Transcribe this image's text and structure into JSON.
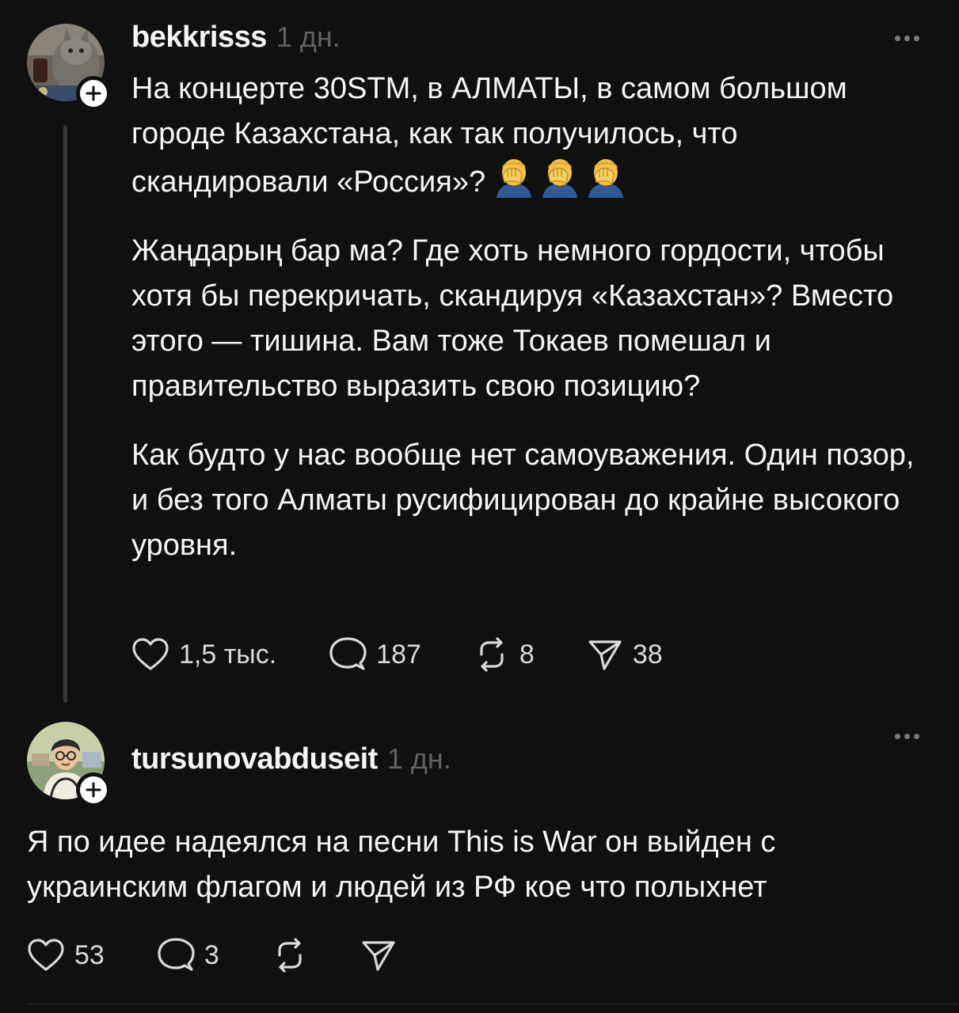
{
  "post1": {
    "username": "bekkrisss",
    "time": "1 дн.",
    "paragraph1": "На концерте 30STM, в АЛМАТЫ, в самом большом городе Казахстана, как так получилось, что скандировали «Россия»?",
    "paragraph1_emojis": [
      "facepalm-emoji",
      "facepalm-emoji",
      "facepalm-emoji"
    ],
    "paragraph2": "Жаңдарың бар ма? Где хоть немного гордости, чтобы хотя бы перекричать, скандируя «Казахстан»? Вместо этого — тишина. Вам тоже Токаев помешал и правительство выразить свою позицию?",
    "paragraph3": "Как будто у нас вообще нет самоуважения. Один позор, и без того Алматы русифицирован до крайне высокого уровня.",
    "likes": "1,5 тыс.",
    "replies": "187",
    "reposts": "8",
    "shares": "38"
  },
  "post2": {
    "username": "tursunovabduseit",
    "time": "1 дн.",
    "text": "Я по идее надеялся на песни This is War он выйден с украинским флагом и людей из РФ кое что полыхнет",
    "likes": "53",
    "replies": "3"
  },
  "colors": {
    "background": "#101010",
    "text": "#f3f5f7",
    "secondary_text": "#616161",
    "thread_line": "#333638"
  },
  "icons": [
    "heart-icon",
    "comment-icon",
    "repost-icon",
    "share-icon",
    "more-icon",
    "follow-plus-icon"
  ]
}
